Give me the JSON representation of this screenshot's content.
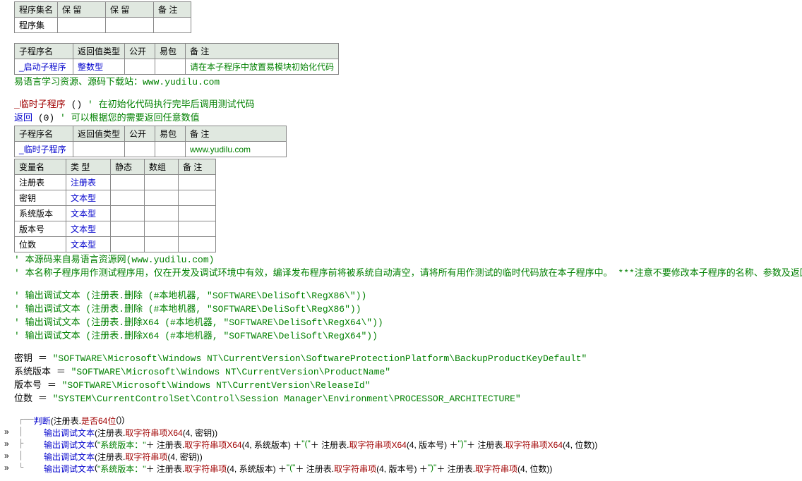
{
  "table1": {
    "headers": [
      "程序集名",
      "保 留",
      "保 留",
      "备 注"
    ],
    "row": [
      "程序集",
      "",
      "",
      ""
    ]
  },
  "table2": {
    "headers": [
      "子程序名",
      "返回值类型",
      "公开",
      "易包",
      "备 注"
    ],
    "row": {
      "name": "_启动子程序",
      "rettype": "整数型",
      "remark": "请在本子程序中放置易模块初始化代码"
    }
  },
  "lineA": {
    "prefix": "' ",
    "text": "易语言学习资源、源码下载站：www.yudilu.com"
  },
  "lineB": {
    "name": "_临时子程序",
    "paren": "()",
    "comment": "' 在初始化代码执行完毕后调用测试代码"
  },
  "lineC": {
    "ret": "返回",
    "args": " (0) ",
    "comment": "' 可以根据您的需要返回任意数值"
  },
  "table3": {
    "headers": [
      "子程序名",
      "返回值类型",
      "公开",
      "易包",
      "备 注"
    ],
    "row": {
      "name": "_临时子程序",
      "remark": "www.yudilu.com"
    }
  },
  "table4": {
    "headers": [
      "变量名",
      "类 型",
      "静态",
      "数组",
      "备 注"
    ],
    "rows": [
      {
        "name": "注册表",
        "type": "注册表"
      },
      {
        "name": "密钥",
        "type": "文本型"
      },
      {
        "name": "系统版本",
        "type": "文本型"
      },
      {
        "name": "版本号",
        "type": "文本型"
      },
      {
        "name": "位数",
        "type": "文本型"
      }
    ]
  },
  "cmt1": "' 本源码来自易语言资源网(www.yudilu.com)",
  "cmt2": "' 本名称子程序用作测试程序用，仅在开发及调试环境中有效，编译发布程序前将被系统自动清空，请将所有用作测试的临时代码放在本子程序中。 ***注意不要修改本子程序的名称、参数及返回值类型。",
  "dbg1": {
    "p": "' ",
    "t": "输出调试文本",
    "a": " (注册表.删除 (#本地机器, ",
    "s": "\"SOFTWARE\\DeliSoft\\RegX86\\\"",
    "e": "))"
  },
  "dbg2": {
    "p": "' ",
    "t": "输出调试文本",
    "a": " (注册表.删除 (#本地机器, ",
    "s": "\"SOFTWARE\\DeliSoft\\RegX86\"",
    "e": "))"
  },
  "dbg3": {
    "p": "' ",
    "t": "输出调试文本",
    "a": " (注册表.删除X64 (#本地机器, ",
    "s": "\"SOFTWARE\\DeliSoft\\RegX64\\\"",
    "e": "))"
  },
  "dbg4": {
    "p": "' ",
    "t": "输出调试文本",
    "a": " (注册表.删除X64 (#本地机器, ",
    "s": "\"SOFTWARE\\DeliSoft\\RegX64\"",
    "e": "))"
  },
  "asn1": {
    "v": "密钥",
    "eq": " ＝ ",
    "s": "\"SOFTWARE\\Microsoft\\Windows NT\\CurrentVersion\\SoftwareProtectionPlatform\\BackupProductKeyDefault\""
  },
  "asn2": {
    "v": "系统版本",
    "eq": " ＝ ",
    "s": "\"SOFTWARE\\Microsoft\\Windows NT\\CurrentVersion\\ProductName\""
  },
  "asn3": {
    "v": "版本号",
    "eq": " ＝ ",
    "s": "\"SOFTWARE\\Microsoft\\Windows NT\\CurrentVersion\\ReleaseId\""
  },
  "asn4": {
    "v": "位数",
    "eq": " ＝ ",
    "s": "\"SYSTEM\\CurrentControlSet\\Control\\Session Manager\\Environment\\PROCESSOR_ARCHITECTURE\""
  },
  "judge": {
    "kw": "判断",
    "lp": " (注册表.",
    "fn": "是否64位",
    "rp": " ())"
  },
  "out1": {
    "kw": "输出调试文本",
    "a": " (注册表.",
    "fn": "取字符串项X64",
    "b": " (4, 密钥))"
  },
  "out2": {
    "kw": "输出调试文本",
    "a": " (",
    "s1": "\"系统版本：\"",
    "b": " ＋ 注册表.",
    "fn1": "取字符串项X64",
    "c": " (4, 系统版本) ＋ ",
    "s2": "\"(\"",
    "d": " ＋ 注册表.",
    "fn2": "取字符串项X64",
    "e": " (4, 版本号) ＋ ",
    "s3": "\")\"",
    "f": " ＋ 注册表.",
    "fn3": "取字符串项X64",
    "g": " (4, 位数))"
  },
  "out3": {
    "kw": "输出调试文本",
    "a": " (注册表.",
    "fn": "取字符串项",
    "b": " (4, 密钥))"
  },
  "out4": {
    "kw": "输出调试文本",
    "a": " (",
    "s1": "\"系统版本：\"",
    "b": " ＋ 注册表.",
    "fn1": "取字符串项",
    "c": " (4, 系统版本) ＋ ",
    "s2": "\"(\"",
    "d": " ＋ 注册表.",
    "fn2": "取字符串项",
    "e": " (4, 版本号) ＋ ",
    "s3": "\")\"",
    "f": " ＋ 注册表.",
    "fn3": "取字符串项",
    "g": " (4, 位数))"
  },
  "arrows": "»"
}
